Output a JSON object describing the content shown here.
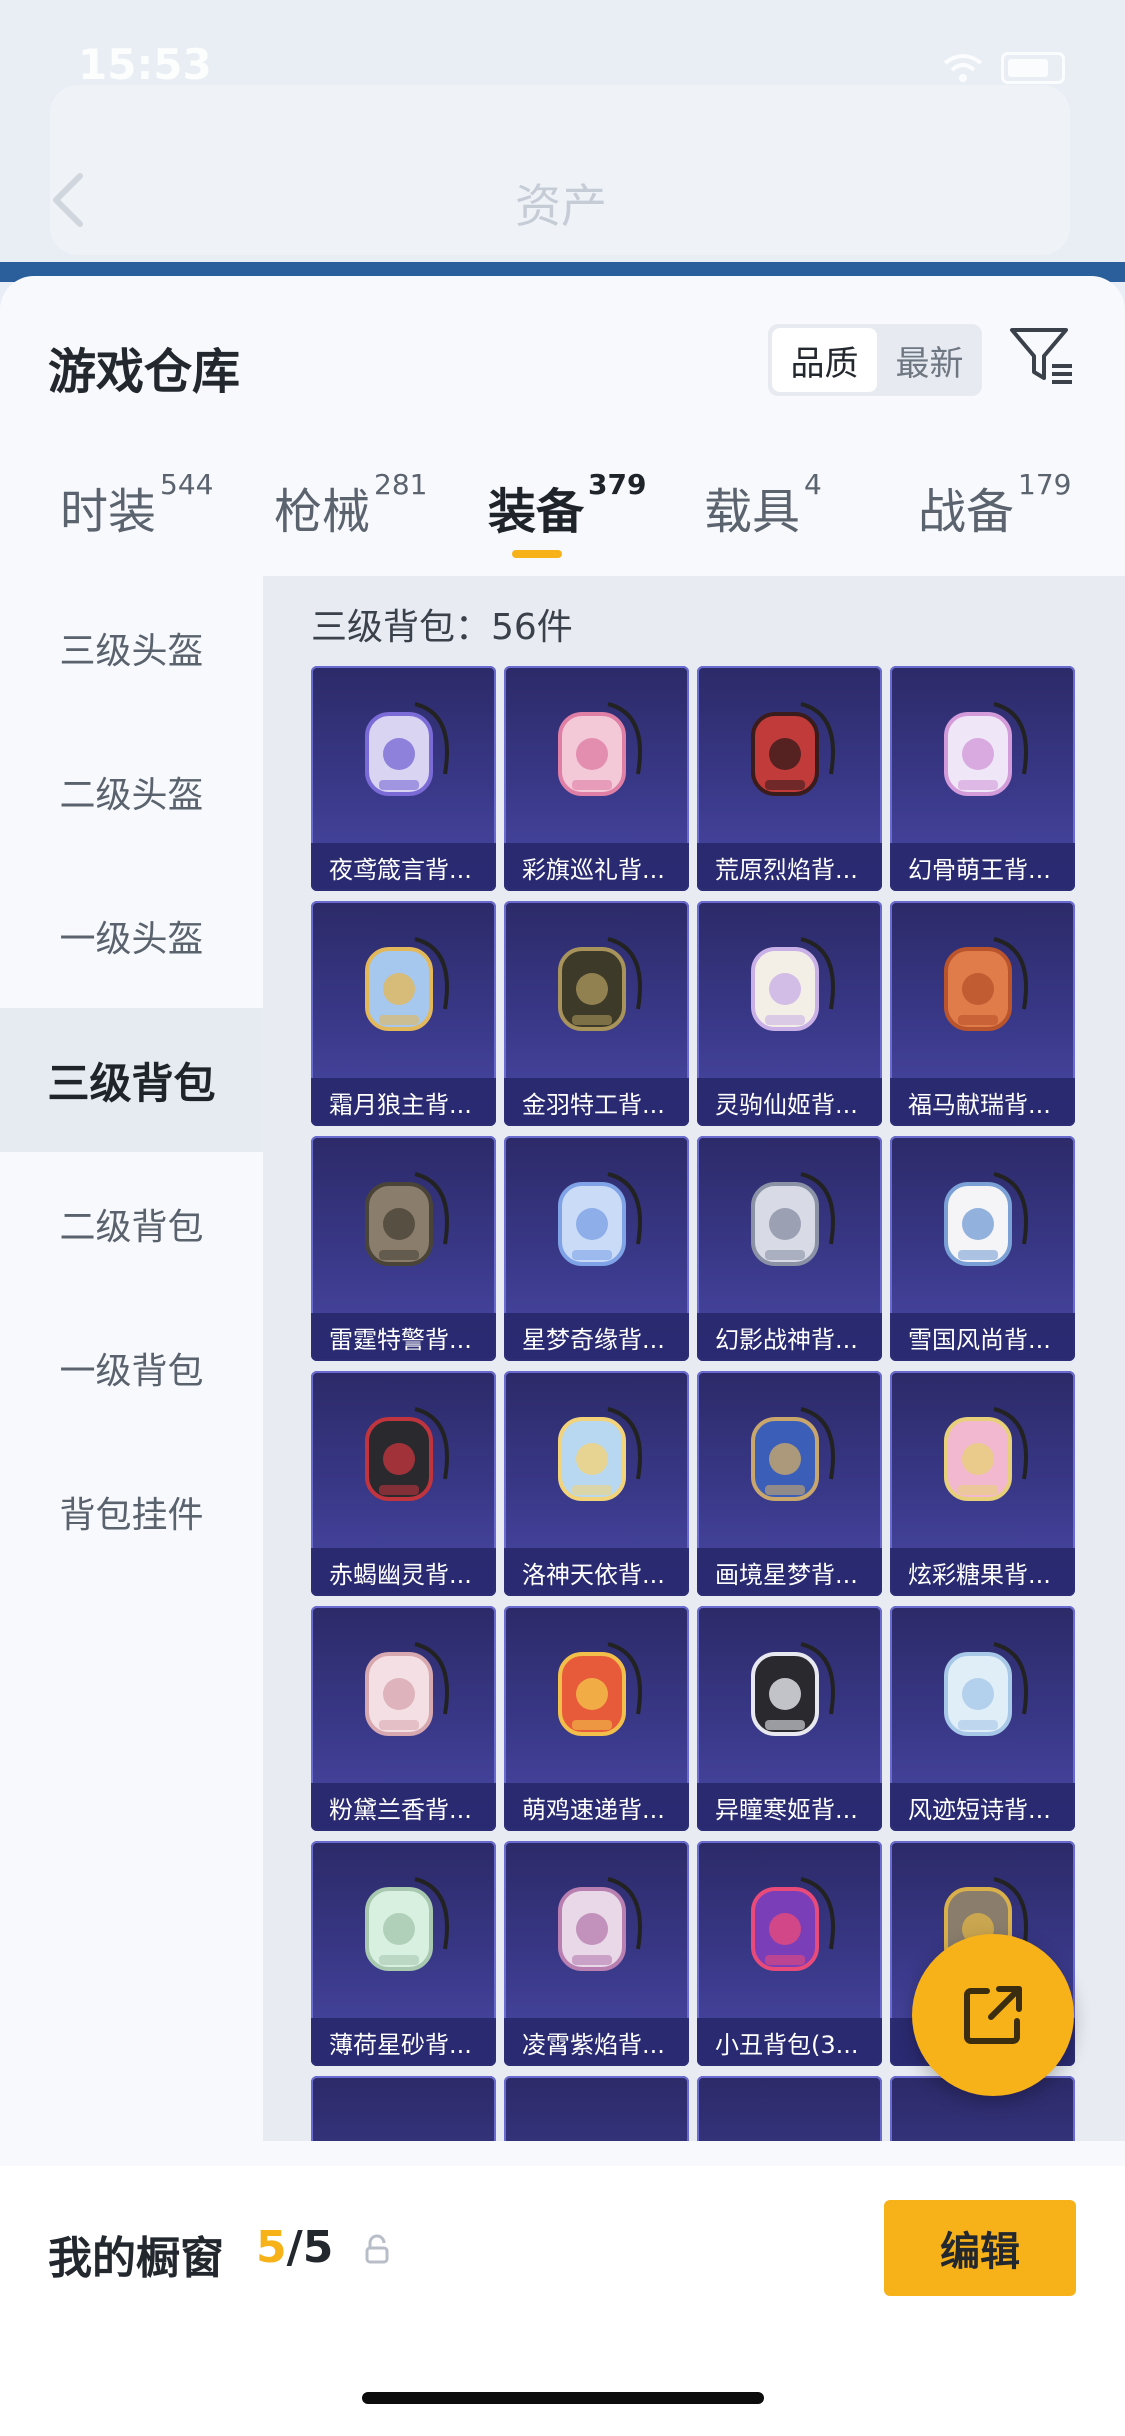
{
  "status_bar": {
    "time": "15:53"
  },
  "background": {
    "title": "资产"
  },
  "sheet": {
    "title": "游戏仓库",
    "sort": {
      "options": [
        "品质",
        "最新"
      ],
      "active": "品质"
    },
    "tabs": [
      {
        "label": "时装",
        "count": "544"
      },
      {
        "label": "枪械",
        "count": "281"
      },
      {
        "label": "装备",
        "count": "379"
      },
      {
        "label": "载具",
        "count": "4"
      },
      {
        "label": "战备",
        "count": "179"
      }
    ],
    "active_tab": "装备",
    "sidebar": [
      {
        "label": "三级头盔"
      },
      {
        "label": "二级头盔"
      },
      {
        "label": "一级头盔"
      },
      {
        "label": "三级背包"
      },
      {
        "label": "二级背包"
      },
      {
        "label": "一级背包"
      },
      {
        "label": "背包挂件"
      }
    ],
    "active_sidebar": "三级背包",
    "count_label": "三级背包：56件",
    "items": [
      {
        "name": "夜鸢箴言背..."
      },
      {
        "name": "彩旗巡礼背..."
      },
      {
        "name": "荒原烈焰背..."
      },
      {
        "name": "幻骨萌王背..."
      },
      {
        "name": "霜月狼主背..."
      },
      {
        "name": "金羽特工背..."
      },
      {
        "name": "灵驹仙姬背..."
      },
      {
        "name": "福马献瑞背..."
      },
      {
        "name": "雷霆特警背..."
      },
      {
        "name": "星梦奇缘背..."
      },
      {
        "name": "幻影战神背..."
      },
      {
        "name": "雪国风尚背..."
      },
      {
        "name": "赤蝎幽灵背..."
      },
      {
        "name": "洛神天依背..."
      },
      {
        "name": "画境星梦背..."
      },
      {
        "name": "炫彩糖果背..."
      },
      {
        "name": "粉黛兰香背..."
      },
      {
        "name": "萌鸡速递背..."
      },
      {
        "name": "异瞳寒姬背..."
      },
      {
        "name": "风迹短诗背..."
      },
      {
        "name": "薄荷星砂背..."
      },
      {
        "name": "凌霄紫焰背..."
      },
      {
        "name": "小丑背包(3..."
      },
      {
        "name": ""
      }
    ]
  },
  "bottom": {
    "window_label": "我的橱窗",
    "window_current": "5",
    "window_total": "/5",
    "edit_label": "编辑"
  },
  "colors": {
    "accent": "#f7b21a",
    "card_bg": "#3b3a8c"
  }
}
